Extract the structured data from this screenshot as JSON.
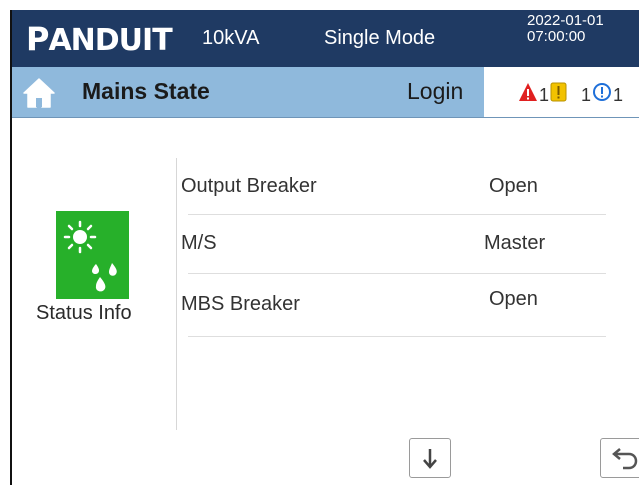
{
  "header": {
    "brand": "PANDUIT",
    "capacity": "10kVA",
    "mode": "Single Mode",
    "date": "2022-01-01",
    "time": "07:00:00"
  },
  "subbar": {
    "home_icon": "home-icon",
    "title": "Mains State",
    "login_label": "Login"
  },
  "alarms": {
    "critical": {
      "icon": "warning-triangle-icon",
      "count": "1",
      "color": "#e02020"
    },
    "major": {
      "icon": "exclamation-square-icon",
      "count": "1",
      "color": "#f2c200"
    },
    "info": {
      "icon": "info-circle-icon",
      "count": "1",
      "color": "#1e6fd9"
    }
  },
  "status_panel": {
    "icon": "status-sun-drops-icon",
    "label": "Status Info",
    "tile_color": "#27b02a"
  },
  "rows": [
    {
      "label": "Output Breaker",
      "value": "Open"
    },
    {
      "label": "M/S",
      "value": "Master"
    },
    {
      "label": "MBS Breaker",
      "value": "Open"
    }
  ],
  "footer": {
    "scroll_down_icon": "arrow-down-icon",
    "back_icon": "back-arrow-icon"
  },
  "colors": {
    "header_bg": "#1f3a63",
    "subbar_bg": "#8fb9dc"
  }
}
